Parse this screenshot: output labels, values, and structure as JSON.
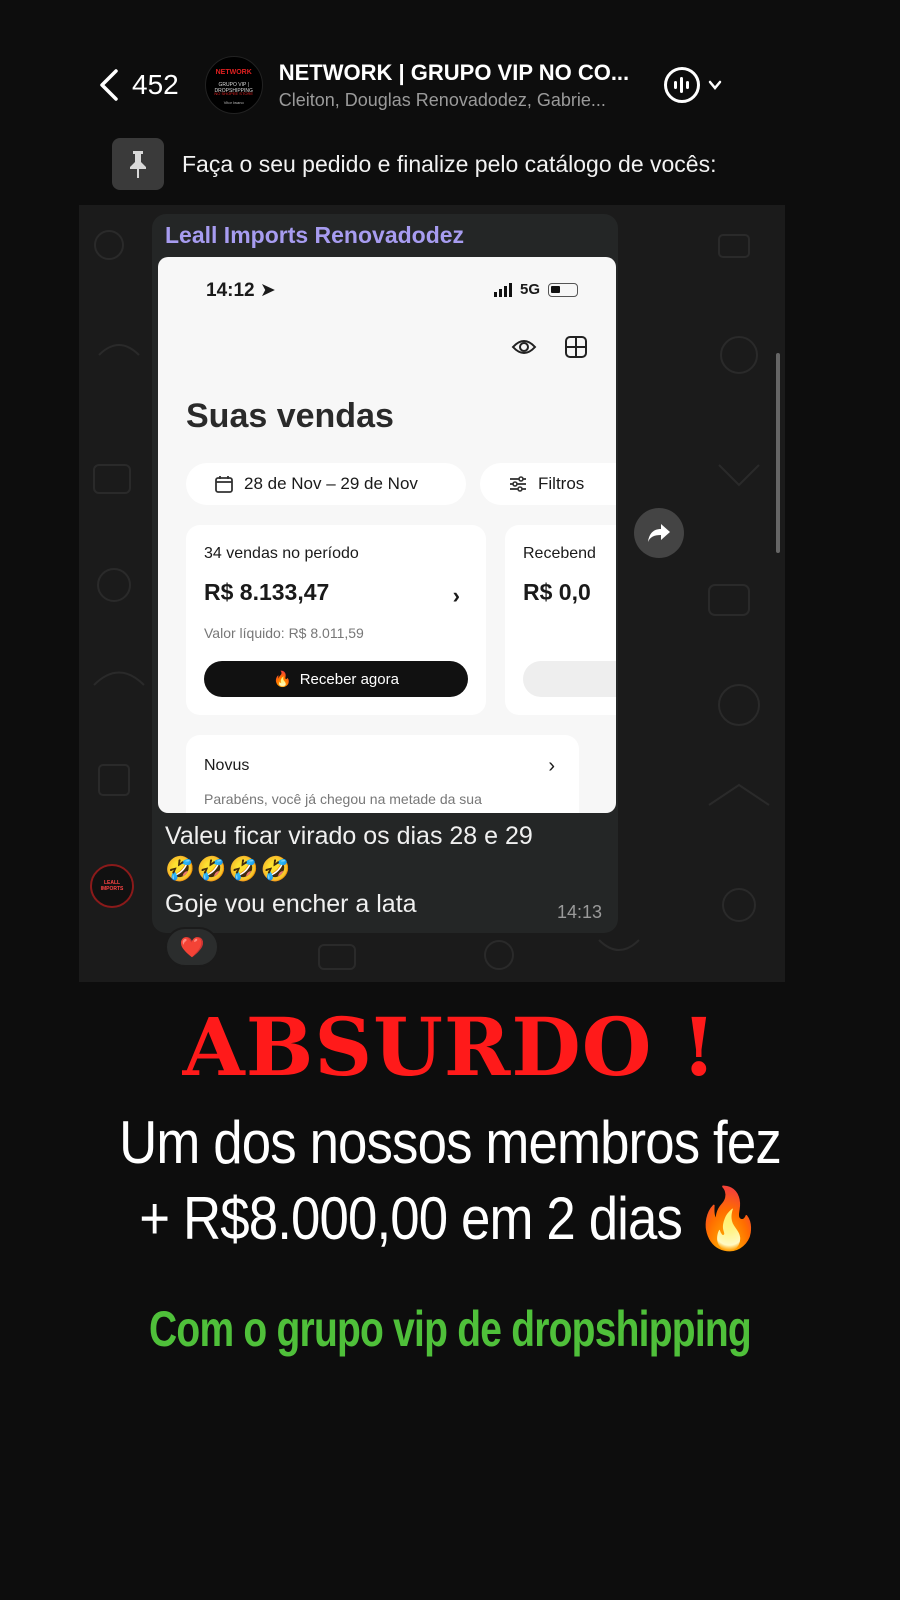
{
  "header": {
    "back_count": "452",
    "group_title": "NETWORK | GRUPO VIP NO CO...",
    "group_subtitle": "Cleiton, Douglas Renovadodez, Gabrie...",
    "avatar_lines": [
      "NETWORK",
      "GRUPO VIP | DROPSHIPPING",
      "NO SHOPEE STORE",
      "Vitor Iwano"
    ]
  },
  "pinned": {
    "text": "Faça o seu pedido e finalize pelo catálogo de vocês:"
  },
  "message": {
    "sender": "Leall Imports Renovadodez",
    "line1": "Valeu ficar virado os dias 28 e 29",
    "emojis": "🤣🤣🤣🤣",
    "line2": "Goje vou encher a lata",
    "time": "14:13",
    "reaction": "❤️",
    "member_avatar_text": "LEALL IMPORTS"
  },
  "screenshot": {
    "status_time": "14:12",
    "network": "5G",
    "title": "Suas vendas",
    "date_range": "28 de Nov – 29 de Nov",
    "filters_label": "Filtros",
    "card1": {
      "label": "34 vendas no período",
      "amount": "R$ 8.133,47",
      "net_value": "Valor líquido: R$ 8.011,59",
      "button_label": "Receber agora"
    },
    "card2": {
      "label": "Recebend",
      "amount": "R$ 0,0"
    },
    "card3": {
      "title": "Novus",
      "text": "Parabéns, você já chegou na metade da sua"
    }
  },
  "promo": {
    "headline": "ABSURDO !",
    "line1": "Um dos nossos membros  fez",
    "line2": "+ R$8.000,00 em 2 dias 🔥",
    "tagline": "Com o grupo vip de dropshipping"
  },
  "colors": {
    "headline": "#ff1a1a",
    "tagline": "#4fc03a",
    "sender": "#a79cf0",
    "background": "#0d0d0d"
  }
}
